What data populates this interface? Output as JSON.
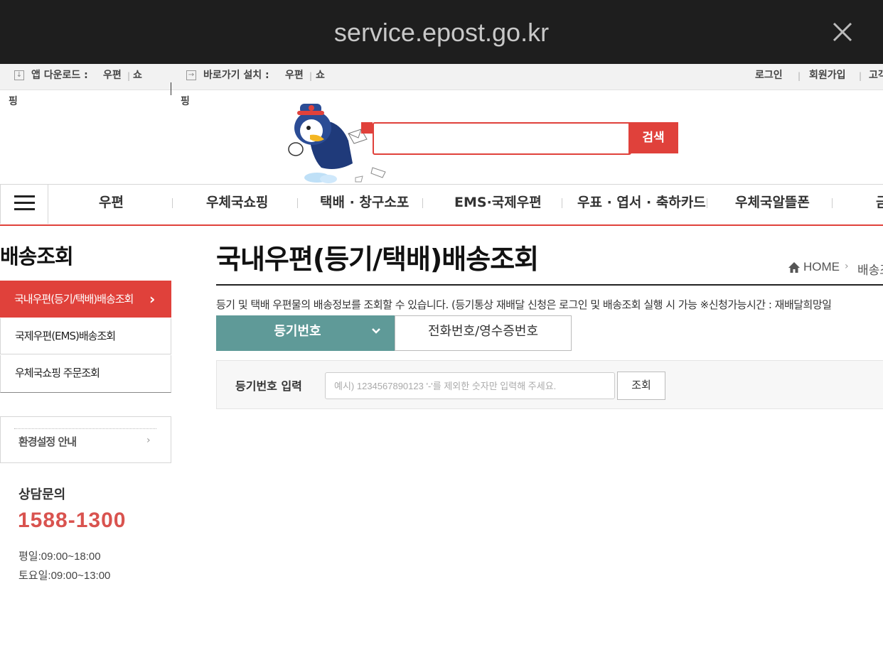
{
  "browser": {
    "url": "service.epost.go.kr"
  },
  "util_bar": {
    "app_download_label": "앱 다운로드 :",
    "app_links": [
      "우편",
      "쇼",
      "핑"
    ],
    "shortcut_label": "바로가기 설치 :",
    "shortcut_links": [
      "우편",
      "쇼",
      "핑"
    ],
    "login": "로그인",
    "signup": "회원가입",
    "customer": "고객"
  },
  "header": {
    "search_button": "검색"
  },
  "gnb": {
    "items": [
      "우편",
      "우체국쇼핑",
      "택배 · 창구소포",
      "EMS·국제우편",
      "우표 · 엽서 · 축하카드",
      "우체국알뜰폰",
      "금"
    ]
  },
  "sidebar": {
    "title": "배송조회",
    "items": [
      {
        "label": "국내우편(등기/택배)배송조회",
        "chevron": "›"
      },
      {
        "label": "국제우편(EMS)배송조회"
      },
      {
        "label": "우체국쇼핑 주문조회"
      }
    ],
    "env_label": "환경설정 안내",
    "env_chevron": "›",
    "consult_title": "상담문의",
    "consult_phone": "1588-1300",
    "hours_weekday": "평일:09:00~18:00",
    "hours_saturday": "토요일:09:00~13:00"
  },
  "main": {
    "title": "국내우편(등기/택배)배송조회",
    "breadcrumb": {
      "home": "HOME",
      "chevron": "›",
      "current": "배송조"
    },
    "description": "등기 및 택배 우편물의 배송정보를 조회할 수 있습니다. (등기통상 재배달 신청은 로그인 및 배송조회 실행 시 가능 ※신청가능시간 : 재배달희망일",
    "tabs": [
      {
        "label": "등기번호"
      },
      {
        "label": "전화번호/영수증번호"
      }
    ],
    "form": {
      "label": "등기번호 입력",
      "placeholder": "예시) 1234567890123 '-'를 제외한 숫자만 입력해 주세요.",
      "query_button": "조회"
    }
  },
  "colors": {
    "accent": "#e0413b",
    "tab_active": "#5f9a98",
    "phone": "#d9534f",
    "browser_bar": "#1e1e1e"
  }
}
